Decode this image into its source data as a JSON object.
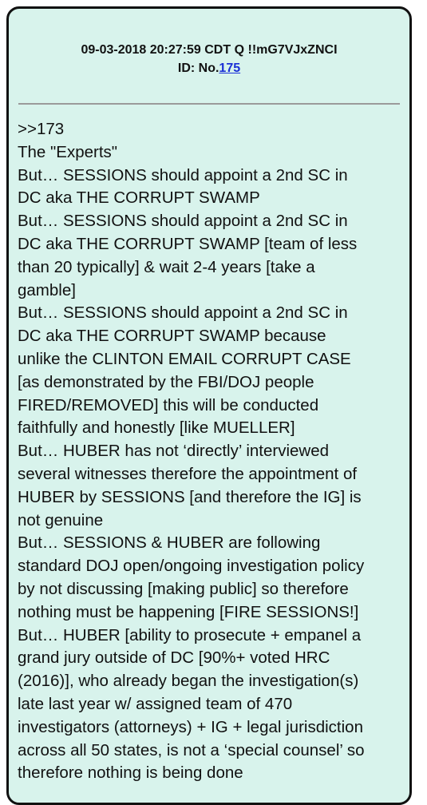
{
  "post": {
    "timestamp": "09-03-2018 20:27:59 CDT",
    "author": "Q !!mG7VJxZNCI",
    "id_label": "ID: No.",
    "id_number": "175"
  },
  "lines": [
    ">>173",
    "The \"Experts\"",
    "But… SESSIONS should appoint a 2nd SC in",
    "DC aka THE CORRUPT SWAMP",
    "But… SESSIONS should appoint a 2nd SC in",
    "DC aka THE CORRUPT SWAMP [team of less",
    "than 20 typically] & wait 2-4 years [take a",
    "gamble]",
    "But… SESSIONS should appoint a 2nd SC in",
    "DC aka THE CORRUPT SWAMP because",
    "unlike the CLINTON EMAIL CORRUPT CASE",
    "[as demonstrated by the FBI/DOJ people",
    "FIRED/REMOVED] this will be conducted",
    "faithfully and honestly [like MUELLER]",
    "But… HUBER has not ‘directly’ interviewed",
    "several witnesses therefore the appointment of",
    "HUBER by SESSIONS [and therefore the IG] is",
    "not genuine",
    "But… SESSIONS & HUBER are following",
    "standard DOJ open/ongoing investigation policy",
    "by not discussing [making public] so therefore",
    "nothing must be happening [FIRE SESSIONS!]",
    "But… HUBER [ability to prosecute + empanel a",
    "grand jury outside of DC [90%+ voted HRC",
    "(2016)], who already began the investigation(s)",
    "late last year w/ assigned team of 470",
    "investigators (attorneys) + IG + legal jurisdiction",
    "across all 50 states, is not a ‘special counsel’ so",
    "therefore nothing is being done"
  ]
}
